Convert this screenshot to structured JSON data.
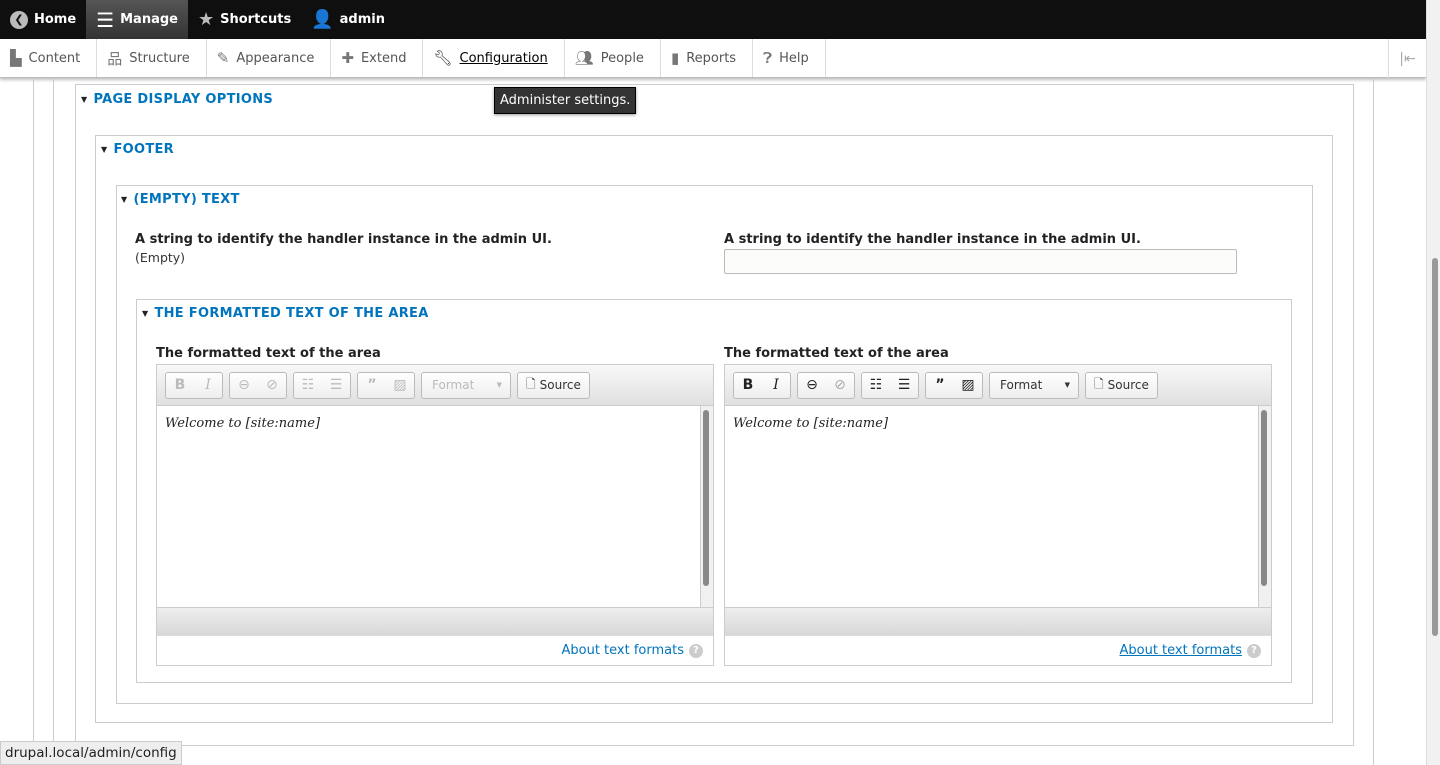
{
  "toolbar": {
    "home": "Home",
    "manage": "Manage",
    "shortcuts": "Shortcuts",
    "user": "admin"
  },
  "tray": [
    {
      "label": "Content",
      "icon": "file-icon"
    },
    {
      "label": "Structure",
      "icon": "sitemap-icon"
    },
    {
      "label": "Appearance",
      "icon": "paintbrush-icon"
    },
    {
      "label": "Extend",
      "icon": "puzzle-icon"
    },
    {
      "label": "Configuration",
      "icon": "wrench-icon"
    },
    {
      "label": "People",
      "icon": "people-icon"
    },
    {
      "label": "Reports",
      "icon": "bar-chart-icon"
    },
    {
      "label": "Help",
      "icon": "help-icon"
    }
  ],
  "tooltip": "Administer settings.",
  "sections": {
    "page_display": "PAGE DISPLAY OPTIONS",
    "footer": "FOOTER",
    "empty_text": "(EMPTY) TEXT",
    "formatted": "THE FORMATTED TEXT OF THE AREA"
  },
  "admin_label": {
    "label": "A string to identify the handler instance in the admin UI.",
    "left_value": "(Empty)",
    "right_value": ""
  },
  "editor": {
    "label": "The formatted text of the area",
    "content": "Welcome to [site:name]",
    "format": "Format",
    "source": "Source",
    "about": "About text formats"
  },
  "status_url": "drupal.local/admin/config"
}
